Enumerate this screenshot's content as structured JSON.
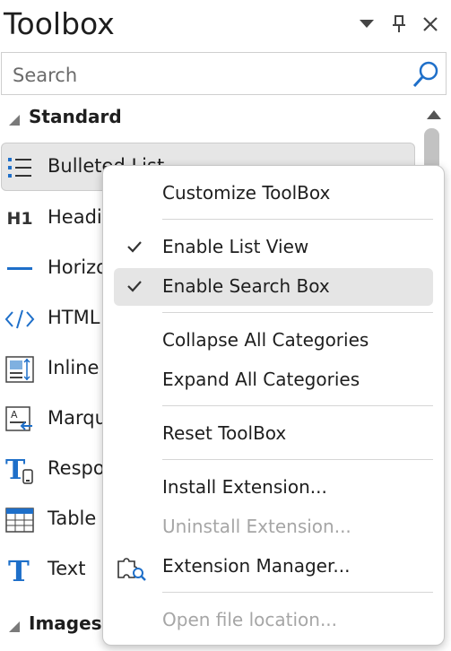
{
  "window": {
    "title": "Toolbox",
    "buttons": [
      "dropdown-arrow",
      "pin",
      "close"
    ]
  },
  "search": {
    "placeholder": "Search"
  },
  "categories": [
    {
      "label": "Standard"
    },
    {
      "label": "Images"
    }
  ],
  "items": [
    {
      "label": "Bulleted List",
      "icon": "bulleted-list-icon"
    },
    {
      "label": "Heading",
      "icon": "heading-icon"
    },
    {
      "label": "Horizontal Line",
      "icon": "horizontal-line-icon"
    },
    {
      "label": "HTML",
      "icon": "html-code-icon"
    },
    {
      "label": "Inline Frame",
      "icon": "inline-frame-icon"
    },
    {
      "label": "Marquee",
      "icon": "marquee-icon"
    },
    {
      "label": "Responsive",
      "icon": "responsive-text-icon"
    },
    {
      "label": "Table",
      "icon": "table-icon"
    },
    {
      "label": "Text",
      "icon": "text-icon"
    }
  ],
  "visible_item_text": [
    "Bulleted List",
    "Headi",
    "Horizo",
    "HTML",
    "Inline",
    "Marqu",
    "Respo",
    "Table",
    "Text"
  ],
  "menu": {
    "items": [
      {
        "label": "Customize ToolBox"
      },
      {
        "label": "Enable List View",
        "checked": true
      },
      {
        "label": "Enable Search Box",
        "checked": true
      },
      {
        "label": "Collapse All Categories"
      },
      {
        "label": "Expand All Categories"
      },
      {
        "label": "Reset ToolBox"
      },
      {
        "label": "Install Extension..."
      },
      {
        "label": "Uninstall Extension...",
        "disabled": true
      },
      {
        "label": "Extension Manager...",
        "icon": "puzzle-gear-icon"
      },
      {
        "label": "Open file location...",
        "disabled": true
      }
    ]
  },
  "colors": {
    "accent": "#1e6fc9",
    "selection": "#e6e6e6",
    "disabled_text": "#a6a6a6"
  }
}
